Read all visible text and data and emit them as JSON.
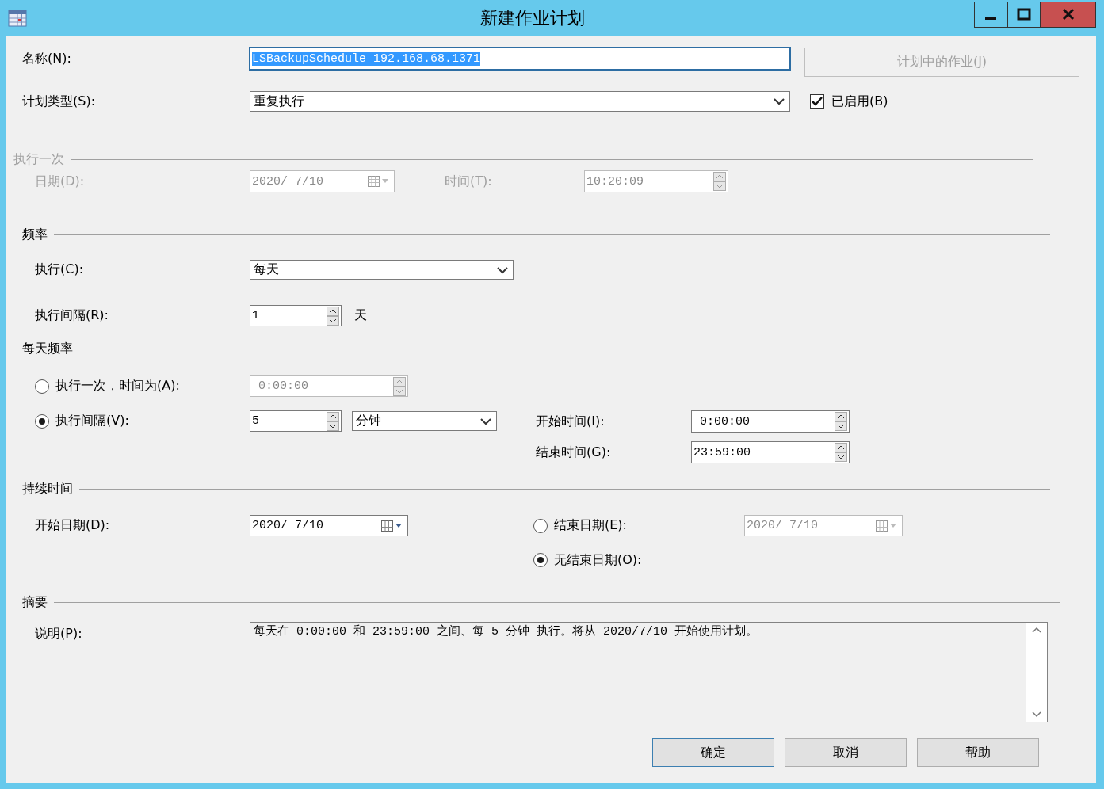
{
  "window": {
    "title": "新建作业计划"
  },
  "name": {
    "label": "名称(N):",
    "value": "LSBackupSchedule_192.168.68.1371",
    "text_selected": true
  },
  "jobs_button": {
    "label": "计划中的作业(J)",
    "disabled": true
  },
  "schedule_type": {
    "label": "计划类型(S):",
    "value": "重复执行"
  },
  "enabled": {
    "label": "已启用(B)",
    "checked": true
  },
  "one_time": {
    "title": "执行一次",
    "disabled": true,
    "date_label": "日期(D):",
    "date": "2020/ 7/10",
    "time_label": "时间(T):",
    "time": "10:20:09"
  },
  "frequency": {
    "title": "频率",
    "occurs_label": "执行(C):",
    "occurs": "每天",
    "recurs_label": "执行间隔(R):",
    "recurs": "1",
    "unit": "天"
  },
  "daily_frequency": {
    "title": "每天频率",
    "options": [
      {
        "label": "执行一次，时间为(A):",
        "selected": false,
        "value": "0:00:00"
      },
      {
        "label": "执行间隔(V):",
        "selected": true,
        "value": "5",
        "unit": "分钟"
      }
    ],
    "start_label": "开始时间(I):",
    "start": "0:00:00",
    "end_label": "结束时间(G):",
    "end": "23:59:00"
  },
  "duration": {
    "title": "持续时间",
    "start_date_label": "开始日期(D):",
    "start_date": "2020/ 7/10",
    "end_options": [
      {
        "label": "结束日期(E):",
        "selected": false,
        "date": "2020/ 7/10"
      },
      {
        "label": "无结束日期(O):",
        "selected": true
      }
    ]
  },
  "summary": {
    "title": "摘要",
    "description_label": "说明(P):",
    "description": "每天在 0:00:00 和 23:59:00 之间、每 5 分钟 执行。将从 2020/7/10 开始使用计划。"
  },
  "buttons": [
    {
      "label": "确定",
      "default": true
    },
    {
      "label": "取消",
      "default": false
    },
    {
      "label": "帮助",
      "default": false
    }
  ]
}
